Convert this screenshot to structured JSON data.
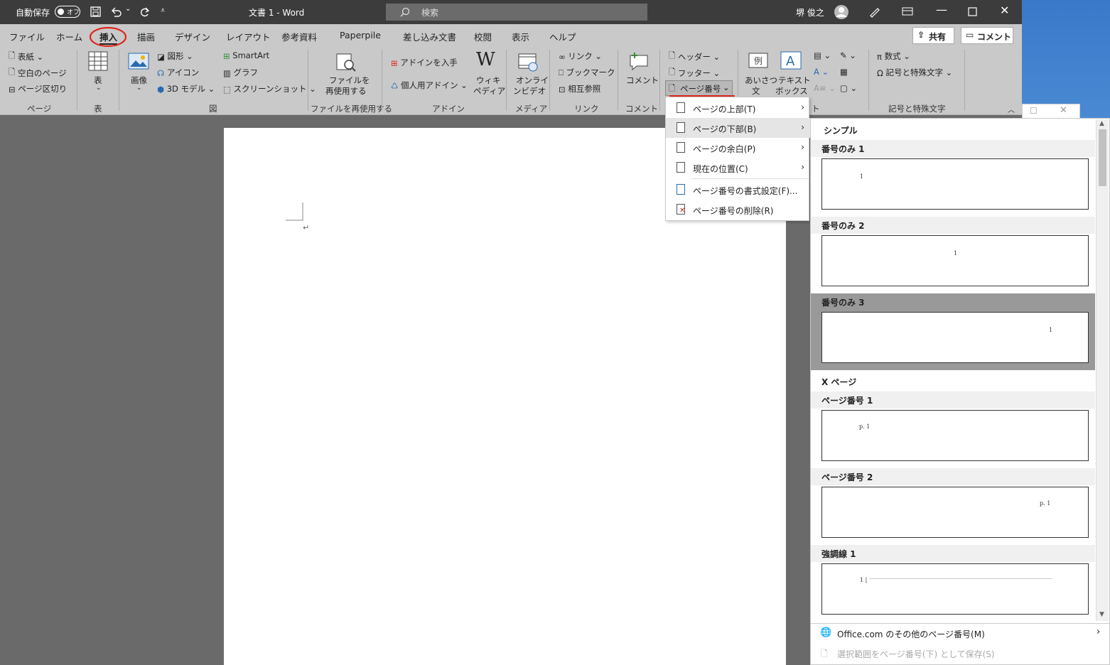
{
  "titlebar": {
    "autosave_label": "自動保存",
    "autosave_state": "オフ",
    "doc_title": "文書 1  -  Word",
    "search_placeholder": "検索",
    "user_name": "堺 俊之"
  },
  "tabs": [
    "ファイル",
    "ホーム",
    "挿入",
    "描画",
    "デザイン",
    "レイアウト",
    "参考資料",
    "Paperpile",
    "差し込み文書",
    "校閲",
    "表示",
    "ヘルプ"
  ],
  "share_label": "共有",
  "comment_label": "コメント",
  "ribbon": {
    "page_group": {
      "items": [
        "表紙",
        "空白のページ",
        "ページ区切り"
      ],
      "label": "ページ"
    },
    "table_group": {
      "item": "表",
      "label": "表"
    },
    "illust_group": {
      "picture": "画像",
      "shape": "図形",
      "icon": "アイコン",
      "model3d": "3D モデル",
      "smartart": "SmartArt",
      "chart": "グラフ",
      "screenshot": "スクリーンショット",
      "label": "図"
    },
    "reuse_group": {
      "item_line1": "ファイルを",
      "item_line2": "再使用する",
      "label": "ファイルを再使用する"
    },
    "addin_group": {
      "get": "アドインを入手",
      "my": "個人用アドイン",
      "wiki_line1": "ウィキ",
      "wiki_line2": "ペディア",
      "label": "アドイン"
    },
    "media_group": {
      "line1": "オンライ",
      "line2": "ンビデオ",
      "label": "メディア"
    },
    "link_group": {
      "link": "リンク",
      "bookmark": "ブックマーク",
      "crossref": "相互参照",
      "label": "リンク"
    },
    "comment_group": {
      "item": "コメント",
      "label": "コメント"
    },
    "hf_group": {
      "header": "ヘッダー",
      "footer": "フッター",
      "pagenum": "ページ番号"
    },
    "text_group": {
      "greet_line1": "あいさつ",
      "greet_line2": "文",
      "textbox_line1": "テキスト",
      "textbox_line2": "ボックス",
      "label_frag": "ト"
    },
    "symbol_group": {
      "equation": "数式",
      "symbol": "記号と特殊文字",
      "label": "記号と特殊文字"
    }
  },
  "submenu": [
    {
      "label": "ページの上部(T)"
    },
    {
      "label": "ページの下部(B)"
    },
    {
      "label": "ページの余白(P)"
    },
    {
      "label": "現在の位置(C)"
    },
    {
      "label": "ページ番号の書式設定(F)..."
    },
    {
      "label": "ページ番号の削除(R)"
    }
  ],
  "gallery": {
    "simple_header": "シンプル",
    "items": [
      {
        "title": "番号のみ 1",
        "text": "1"
      },
      {
        "title": "番号のみ 2",
        "text": "1"
      },
      {
        "title": "番号のみ 3",
        "text": "1"
      },
      {
        "title": "X ページ",
        "text": ""
      },
      {
        "title": "ページ番号 1",
        "text": "p. 1"
      },
      {
        "title": "ページ番号 2",
        "text": "p. 1"
      },
      {
        "title": "強調線 1",
        "text": "1 |"
      }
    ],
    "footer_more": "Office.com のその他のページ番号(M)",
    "footer_save": "選択範囲をページ番号(下) として保存(S)"
  },
  "colors": {
    "accent_red": "#e0261e",
    "ribbon_bg": "#c9c9c9",
    "titlebar_bg": "#3c3c3c"
  }
}
